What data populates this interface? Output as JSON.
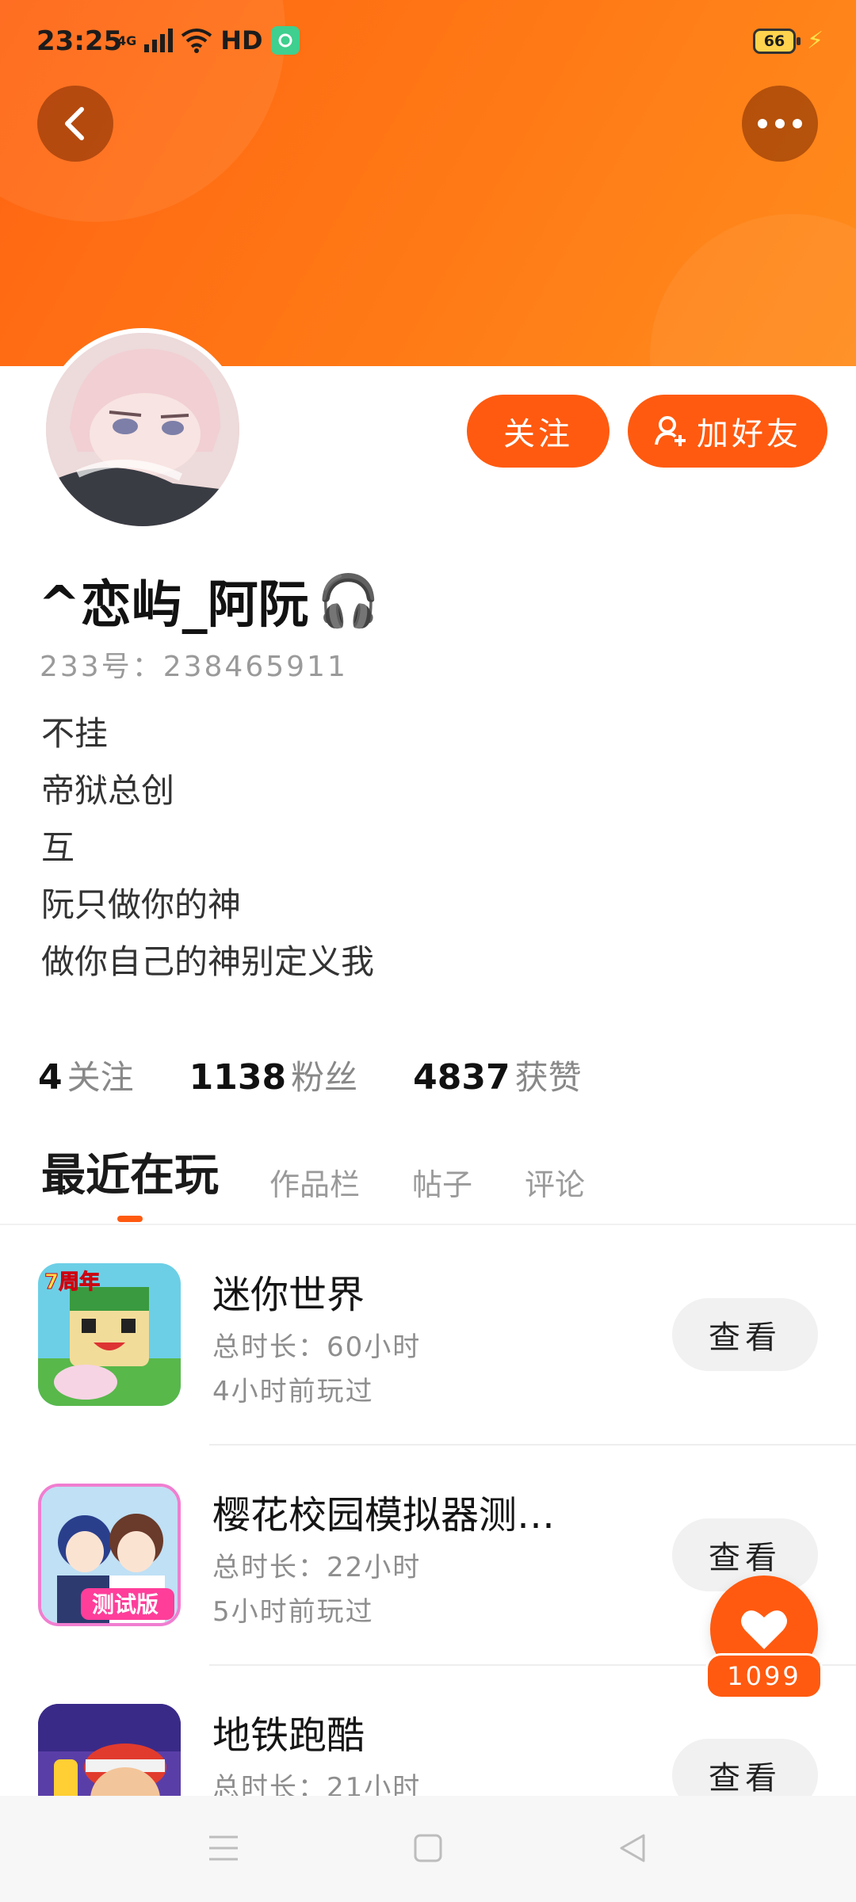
{
  "status_bar": {
    "time": "23:25",
    "network": "4G",
    "hd": "HD",
    "battery": "66"
  },
  "header": {
    "back_icon": "chevron-left-icon",
    "more_icon": "more-horizontal-icon",
    "gradient_colors": [
      "#ff6412",
      "#ff8c1c"
    ]
  },
  "profile": {
    "username": "^恋屿_阿阮",
    "username_emoji": "🎧",
    "id_line": "233号：238465911",
    "bio": [
      "不挂",
      "帝狱总创",
      "互",
      "阮只做你的神",
      "做你自己的神别定义我"
    ],
    "follow_label": "关注",
    "add_friend_label": "加好友"
  },
  "stats": [
    {
      "value": "4",
      "label": "关注"
    },
    {
      "value": "1138",
      "label": "粉丝"
    },
    {
      "value": "4837",
      "label": "获赞"
    }
  ],
  "tabs": [
    "最近在玩",
    "作品栏",
    "帖子",
    "评论"
  ],
  "games": [
    {
      "title": "迷你世界",
      "duration": "总时长：60小时",
      "last_played": "4小时前玩过",
      "button": "查看",
      "icon_text": "7周年"
    },
    {
      "title": "樱花校园模拟器测…",
      "duration": "总时长：22小时",
      "last_played": "5小时前玩过",
      "button": "查看",
      "icon_text": "测试版"
    },
    {
      "title": "地铁跑酷",
      "duration": "总时长：21小时",
      "last_played": "",
      "button": "查看",
      "icon_text": ""
    }
  ],
  "like": {
    "count": "1099",
    "icon": "heart-icon"
  },
  "accent_color": "#ff5a10"
}
